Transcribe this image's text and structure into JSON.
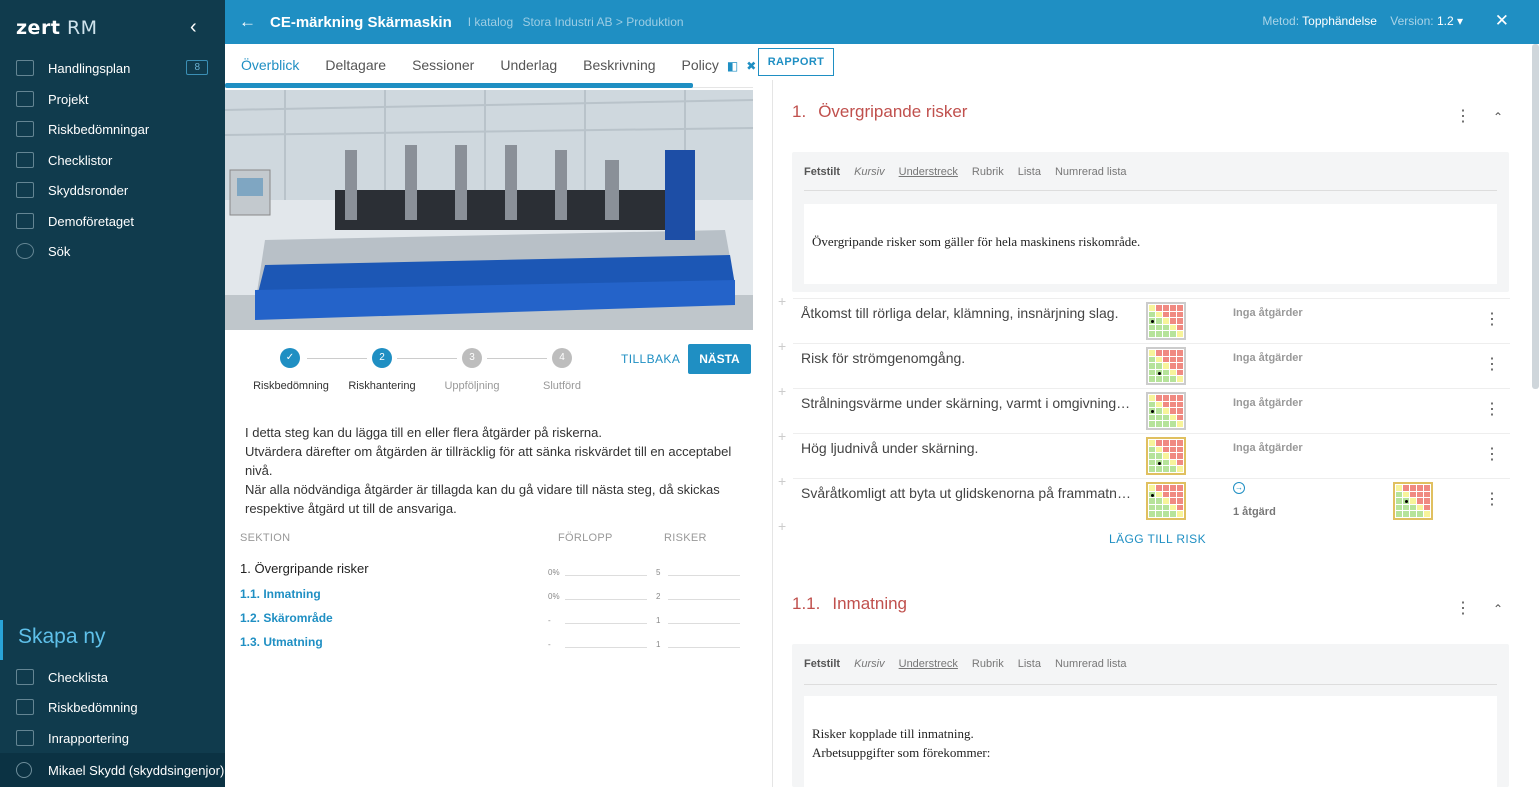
{
  "app": {
    "logo_light": "zert",
    "logo_name": " RM"
  },
  "sidebar": {
    "items": [
      {
        "label": "Handlingsplan",
        "badge": "8",
        "icon": "lightbulb-icon"
      },
      {
        "label": "Projekt",
        "icon": "calendar-icon"
      },
      {
        "label": "Riskbedömningar",
        "icon": "clipboard-icon"
      },
      {
        "label": "Checklistor",
        "icon": "list-icon"
      },
      {
        "label": "Skyddsronder",
        "icon": "clipboard-check-icon"
      },
      {
        "label": "Demoföretaget",
        "icon": "org-chart-icon"
      },
      {
        "label": "Sök",
        "icon": "search-icon"
      }
    ],
    "create_title": "Skapa ny",
    "create_items": [
      {
        "label": "Checklista",
        "icon": "list-icon"
      },
      {
        "label": "Riskbedömning",
        "icon": "clipboard-icon"
      },
      {
        "label": "Inrapportering",
        "icon": "warning-icon"
      }
    ],
    "user": "Mikael Skydd (skyddsingenjor)"
  },
  "header": {
    "title": "CE-märkning Skärmaskin",
    "catalog_label": "I katalog",
    "catalog_path": "Stora Industri AB > Produktion",
    "method_label": "Metod:",
    "method_value": "Topphändelse",
    "version_label": "Version:",
    "version_value": "1.2 ▾"
  },
  "tabs": [
    "Överblick",
    "Deltagare",
    "Sessioner",
    "Underlag",
    "Beskrivning",
    "Policy"
  ],
  "report_button": "RAPPORT",
  "steps": {
    "labels": [
      "Riskbedömning",
      "Riskhantering",
      "Uppföljning",
      "Slutförd"
    ],
    "numbers": [
      "2",
      "3",
      "4"
    ],
    "back": "TILLBAKA",
    "next": "NÄSTA"
  },
  "description": [
    "I detta steg kan du lägga till en eller flera åtgärder på riskerna.",
    "Utvärdera därefter om åtgärden är tillräcklig för att sänka riskvärdet till en acceptabel nivå.",
    "När alla nödvändiga åtgärder är tillagda kan du gå vidare till nästa steg, då skickas respektive åtgärd ut till de ansvariga."
  ],
  "section_table": {
    "headers": {
      "section": "SEKTION",
      "progress": "FÖRLOPP",
      "risks": "RISKER"
    },
    "rows": [
      {
        "name": "1. Övergripande risker",
        "progress": "0%",
        "risks": "5"
      },
      {
        "name": "1.1. Inmatning",
        "progress": "0%",
        "risks": "2"
      },
      {
        "name": "1.2. Skärområde",
        "progress": "-",
        "risks": "1"
      },
      {
        "name": "1.3. Utmatning",
        "progress": "-",
        "risks": "1"
      }
    ]
  },
  "editor_toolbar": [
    "Fetstilt",
    "Kursiv",
    "Understreck",
    "Rubrik",
    "Lista",
    "Numrerad lista"
  ],
  "section1": {
    "number": "1.",
    "title": "Övergripande risker",
    "text": "Övergripande risker som gäller för hela maskinens riskområde.",
    "risks": [
      {
        "text": "Åtkomst till rörliga delar, klämning, insnärjning slag.",
        "actions": "Inga åtgärder"
      },
      {
        "text": "Risk för strömgenomgång.",
        "actions": "Inga åtgärder"
      },
      {
        "text": "Strålningsvärme under skärning, varmt i omgivningen.",
        "actions": "Inga åtgärder"
      },
      {
        "text": "Hög ljudnivå under skärning.",
        "actions": "Inga åtgärder"
      },
      {
        "text": "Svåråtkomligt att byta ut glidskenorna på frammatningen.",
        "actions": "1 åtgärd"
      }
    ],
    "add_risk": "LÄGG TILL RISK"
  },
  "section11": {
    "number": "1.1.",
    "title": "Inmatning",
    "text_lines": [
      "Risker kopplade till inmatning.",
      "Arbetsuppgifter som förekommer:"
    ]
  }
}
